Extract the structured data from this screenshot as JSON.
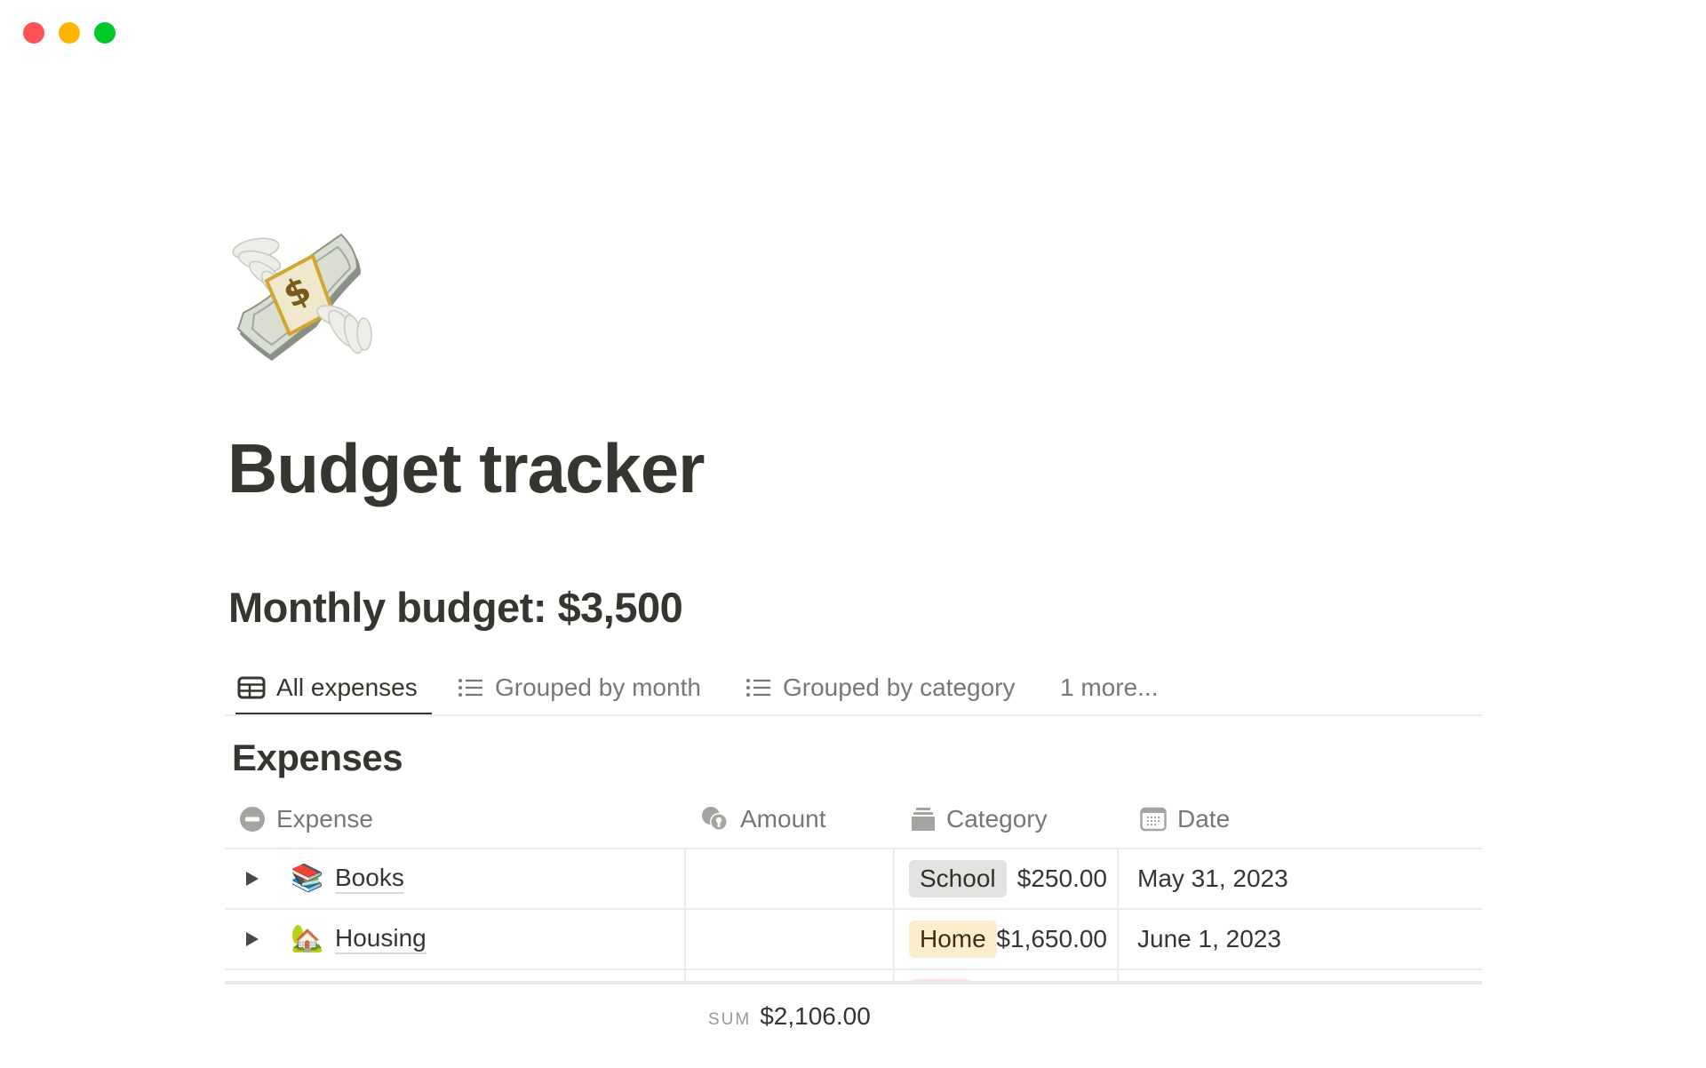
{
  "window": {
    "controls": [
      "close",
      "minimize",
      "zoom"
    ],
    "colors": {
      "close": "#ff5257",
      "minimize": "#ffb400",
      "zoom": "#00c92a"
    }
  },
  "page": {
    "icon": "money-with-wings-emoji",
    "title": "Budget tracker",
    "subheading": "Monthly budget: $3,500"
  },
  "tabs": [
    {
      "label": "All expenses",
      "icon": "table-icon",
      "active": true
    },
    {
      "label": "Grouped by month",
      "icon": "list-icon",
      "active": false
    },
    {
      "label": "Grouped by category",
      "icon": "list-icon",
      "active": false
    },
    {
      "label": "1 more...",
      "icon": null,
      "active": false
    }
  ],
  "database": {
    "title": "Expenses",
    "columns": [
      {
        "label": "Expense",
        "icon": "title-icon"
      },
      {
        "label": "Amount",
        "icon": "formula-coins-icon"
      },
      {
        "label": "Category",
        "icon": "select-icon"
      },
      {
        "label": "Date",
        "icon": "calendar-icon"
      }
    ],
    "rows": [
      {
        "emoji": "📚",
        "emoji_name": "books-emoji",
        "expense": "Books",
        "amount": "$250.00",
        "category": "School",
        "category_color": "#e3e2e0",
        "date": "May 31, 2023"
      },
      {
        "emoji": "🏡",
        "emoji_name": "house-with-garden-emoji",
        "expense": "Housing",
        "amount": "$1,650.00",
        "category": "Home",
        "category_color": "#fbeecc",
        "date": "June 1, 2023"
      }
    ],
    "partial_row": {
      "category_color": "#fbe4e4"
    },
    "footer": {
      "sum_label": "SUM",
      "sum_value": "$2,106.00"
    }
  },
  "colors": {
    "text": "#37352f",
    "muted": "#787774",
    "border": "#ebebea"
  }
}
